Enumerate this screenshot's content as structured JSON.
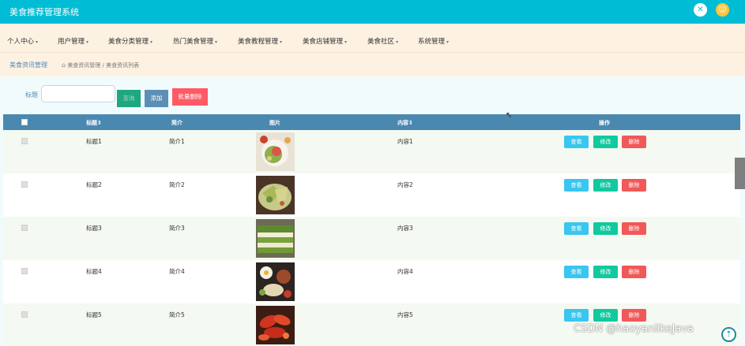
{
  "app": {
    "title": "美食推荐管理系统"
  },
  "icons": {
    "fullscreen": "fullscreen-icon",
    "user": "user-avatar-icon",
    "home": "home-icon",
    "back_top": "back-to-top-icon"
  },
  "nav": {
    "items": [
      {
        "label": "个人中心",
        "caret": "▾"
      },
      {
        "label": "用户管理",
        "caret": "▾"
      },
      {
        "label": "美食分类管理",
        "caret": "▾"
      },
      {
        "label": "热门美食管理",
        "caret": "▾"
      },
      {
        "label": "美食教程管理",
        "caret": "▾"
      },
      {
        "label": "美食店铺管理",
        "caret": "▾"
      },
      {
        "label": "美食社区",
        "caret": "▾"
      },
      {
        "label": "系统管理",
        "caret": "▾"
      }
    ]
  },
  "breadcrumb": {
    "title": "美食资讯管理",
    "path": "美食资讯管理 / 美食资讯列表"
  },
  "search": {
    "label": "标题",
    "value": "",
    "placeholder": "",
    "query_label": "查询",
    "add_label": "添加",
    "batch_delete_label": "批量删除"
  },
  "table": {
    "headers": {
      "title": "标题⇕",
      "intro": "简介",
      "image": "图片",
      "content": "内容⇕",
      "actions": "操作"
    },
    "rows": [
      {
        "title": "标题1",
        "intro": "简介1",
        "content": "内容1",
        "view": "查看",
        "edit": "修改",
        "del": "删除"
      },
      {
        "title": "标题2",
        "intro": "简介2",
        "content": "内容2",
        "view": "查看",
        "edit": "修改",
        "del": "删除"
      },
      {
        "title": "标题3",
        "intro": "简介3",
        "content": "内容3",
        "view": "查看",
        "edit": "修改",
        "del": "删除"
      },
      {
        "title": "标题4",
        "intro": "简介4",
        "content": "内容4",
        "view": "查看",
        "edit": "修改",
        "del": "删除"
      },
      {
        "title": "标题5",
        "intro": "简介5",
        "content": "内容5",
        "view": "查看",
        "edit": "修改",
        "del": "删除"
      }
    ]
  },
  "watermark": "CSDN @haoyanlikeJava",
  "colors": {
    "topbar": "#00bcd4",
    "navbar": "#fdf1e2",
    "header": "#4a88b0",
    "view": "#39c6f0",
    "edit": "#11c99e",
    "delete": "#f15858"
  }
}
